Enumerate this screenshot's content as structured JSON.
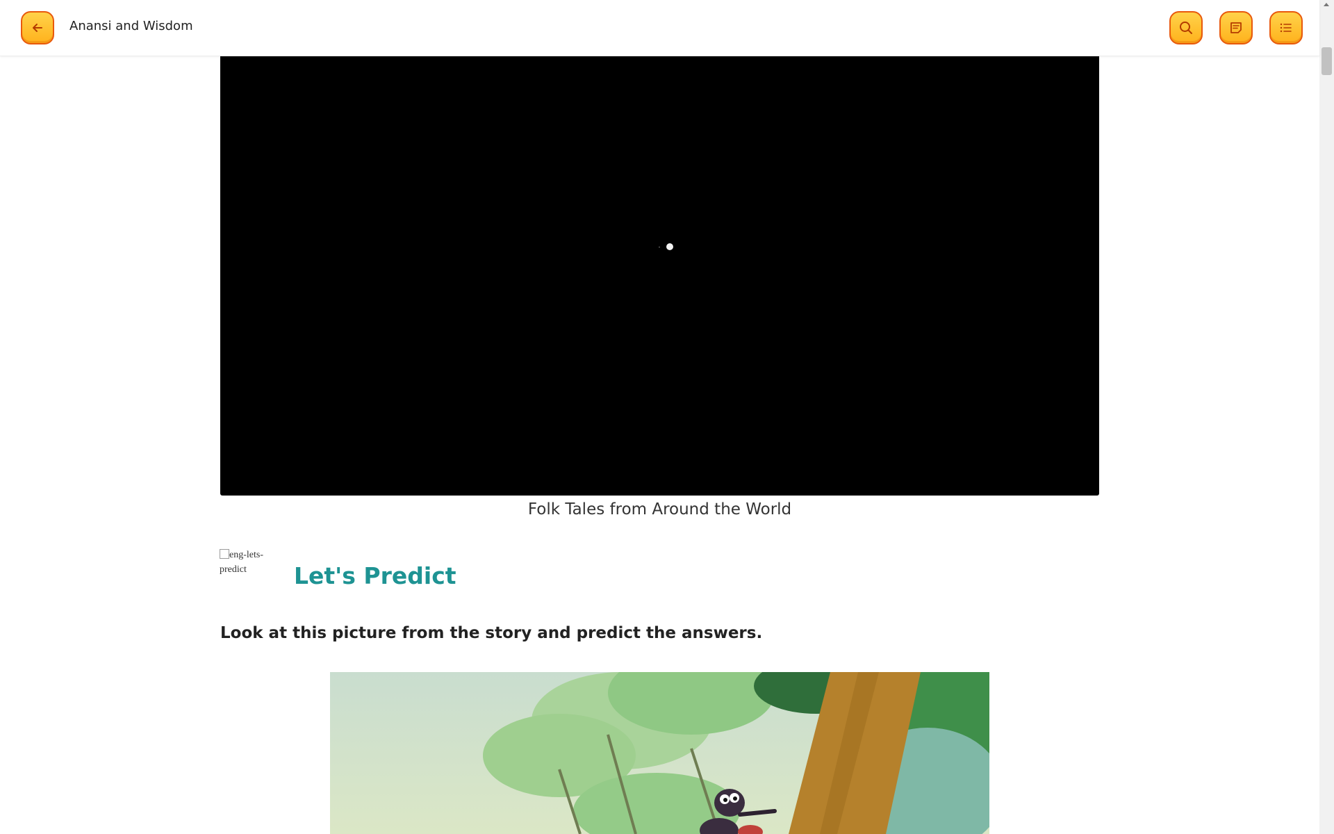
{
  "header": {
    "title": "Anansi and Wisdom",
    "back_icon": "arrow-left-icon",
    "search_icon": "search-icon",
    "notes_icon": "notes-icon",
    "toc_icon": "list-icon"
  },
  "video": {
    "caption": "Folk Tales from Around the World"
  },
  "section": {
    "icon_alt": "eng-lets-predict",
    "title": "Let's Predict",
    "instruction": "Look at this picture from the story and predict the answers."
  },
  "colors": {
    "accent_button": "#ffc12e",
    "button_border": "#e8590c",
    "heading_teal": "#1e9393"
  }
}
